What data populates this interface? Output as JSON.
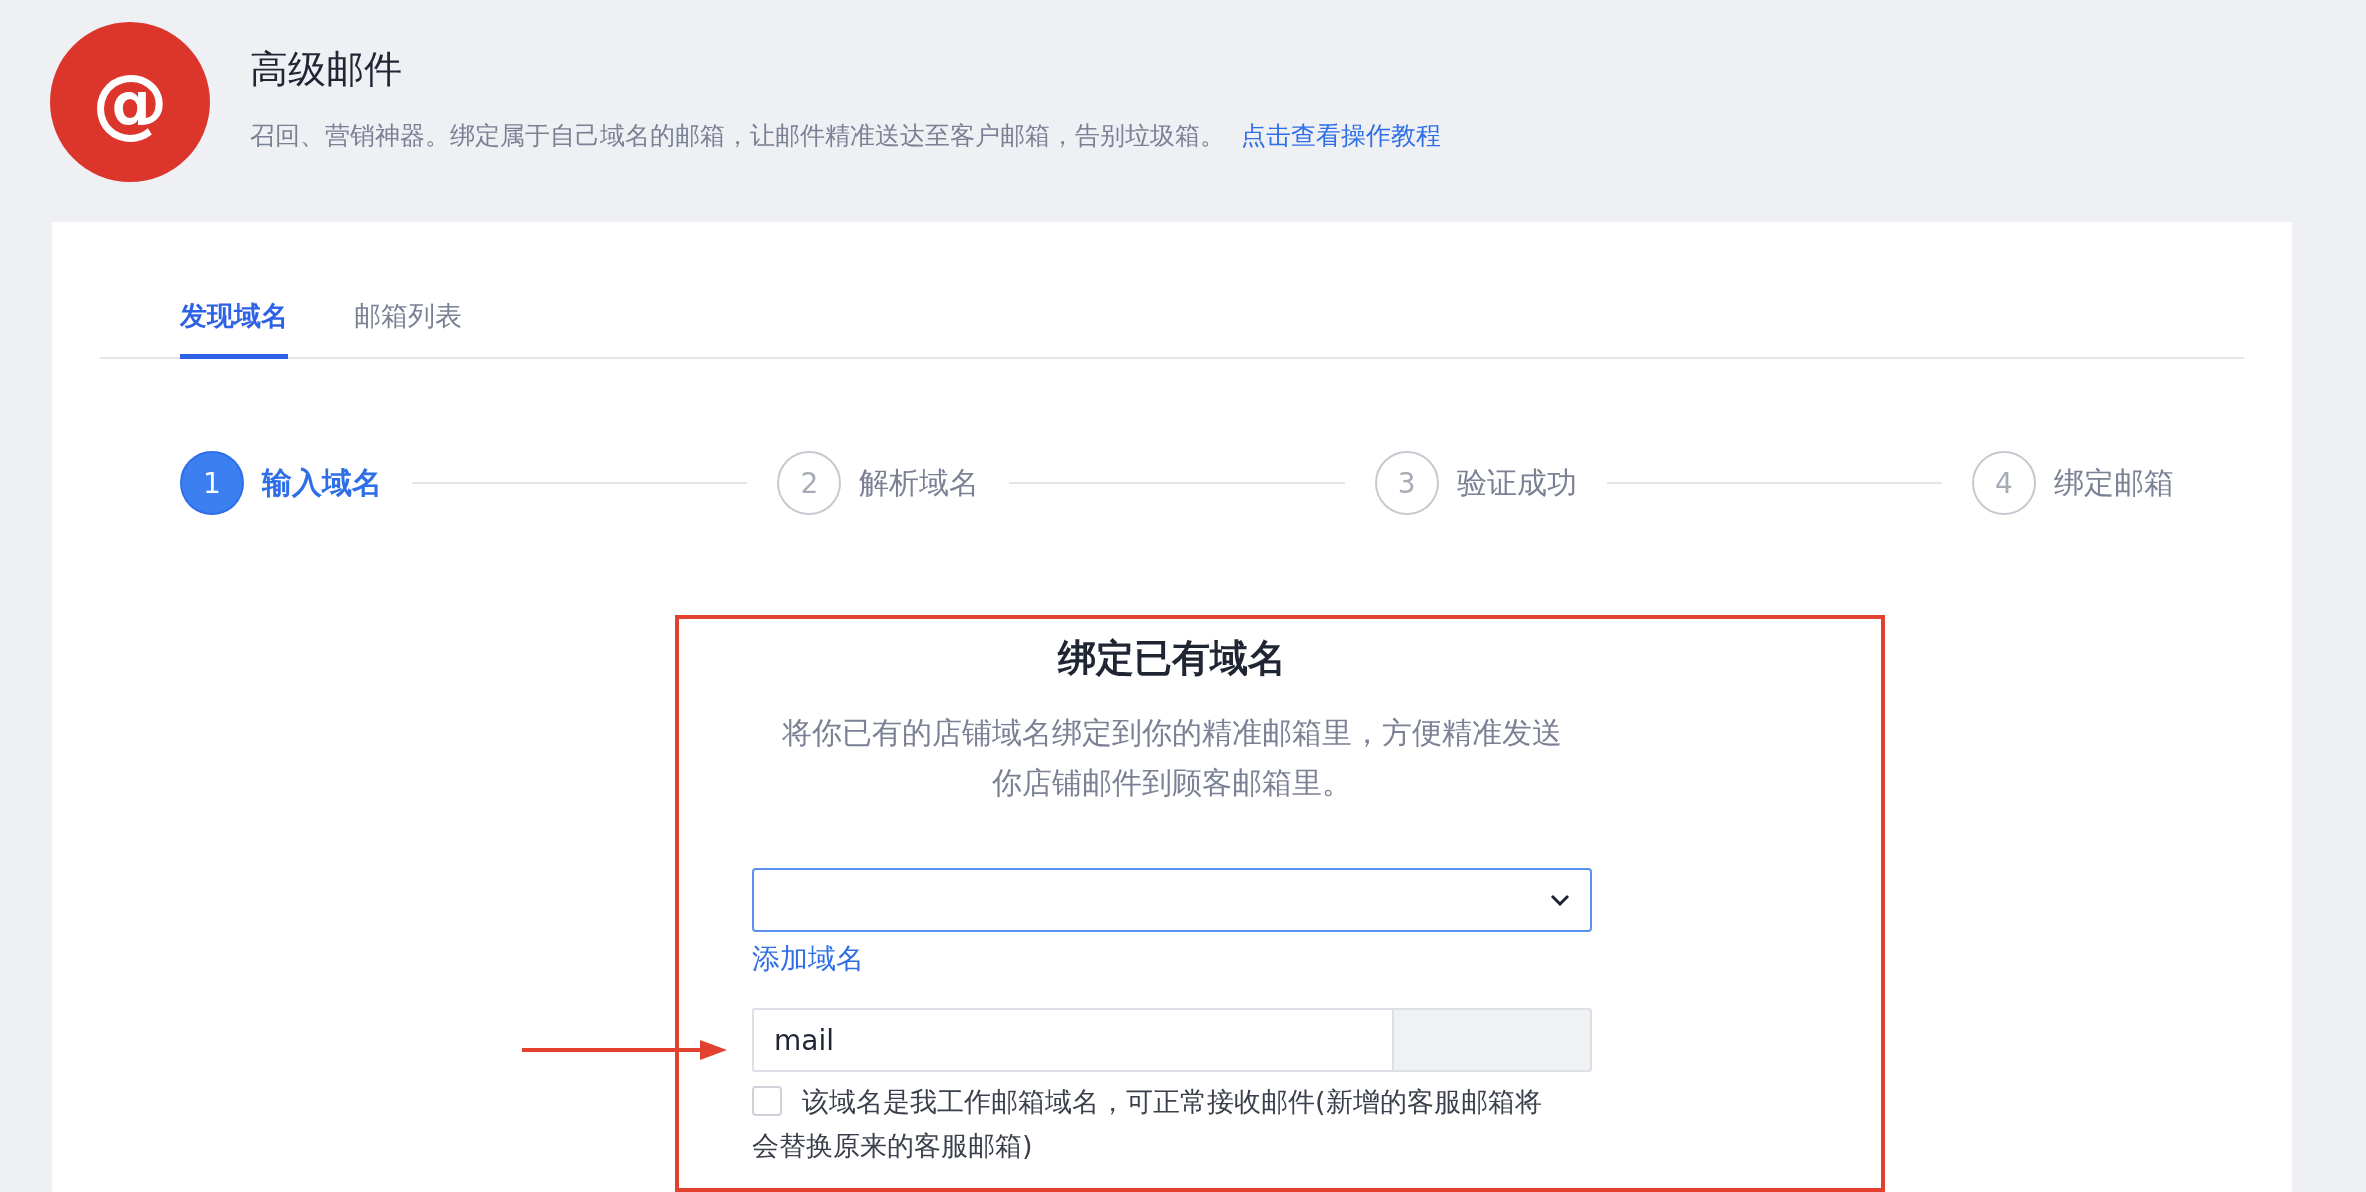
{
  "header": {
    "logo": "@",
    "title": "高级邮件",
    "description": "召回、营销神器。绑定属于自己域名的邮箱，让邮件精准送达至客户邮箱，告别垃圾箱。",
    "link": "点击查看操作教程"
  },
  "tabs": [
    {
      "label": "发现域名",
      "selected": true
    },
    {
      "label": "邮箱列表",
      "selected": false
    }
  ],
  "steps": [
    {
      "number": "1",
      "label": "输入域名",
      "active": true
    },
    {
      "number": "2",
      "label": "解析域名",
      "active": false
    },
    {
      "number": "3",
      "label": "验证成功",
      "active": false
    },
    {
      "number": "4",
      "label": "绑定邮箱",
      "active": false
    }
  ],
  "bind_panel": {
    "title": "绑定已有域名",
    "description": "将你已有的店铺域名绑定到你的精准邮箱里，方便精准发送你店铺邮件到顾客邮箱里。",
    "add_link": "添加域名",
    "subdomain_value": "mail",
    "checkbox": {
      "checked": false,
      "label": "该域名是我工作邮箱域名，可正常接收邮件(新增的客服邮箱将会替换原来的客服邮箱)"
    }
  }
}
